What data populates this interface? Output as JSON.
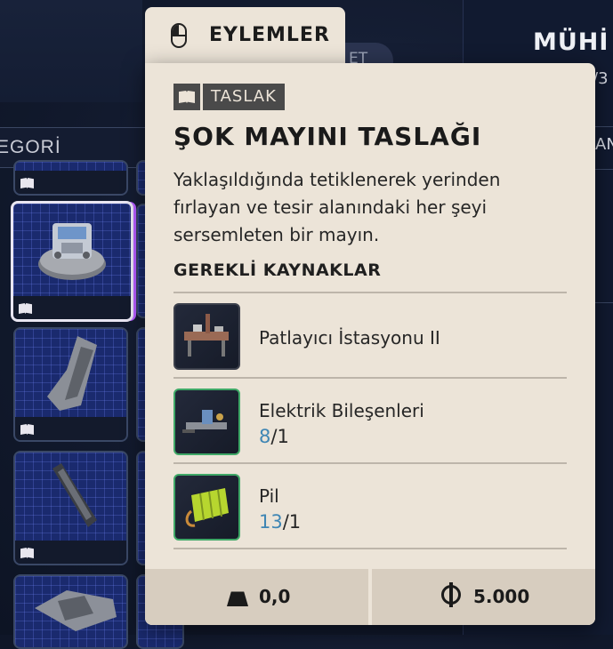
{
  "background": {
    "categories_label": "EGORİ",
    "ghost_tab_label": "ET",
    "right_title": "MÜHİ",
    "right_fraction": "/3",
    "right_label": "AN"
  },
  "actions_tab": {
    "label": "EYLEMLER",
    "icon": "mouse-icon"
  },
  "item": {
    "type_badge": "TASLAK",
    "type_icon": "book-icon",
    "name": "ŞOK MAYINI TASLAĞI",
    "description": "Yaklaşıldığında tetiklenerek yerinden fırlayan ve tesir alanındaki her şeyi sersemleten bir mayın."
  },
  "resources": {
    "title": "GEREKLİ KAYNAKLAR",
    "items": [
      {
        "name": "Patlayıcı İstasyonu II",
        "have": "",
        "need": ""
      },
      {
        "name": "Elektrik Bileşenleri",
        "have": "8",
        "need": "/1"
      },
      {
        "name": "Pil",
        "have": "13",
        "need": "/1"
      }
    ]
  },
  "footer": {
    "weight": "0,0",
    "price": "5.000"
  },
  "colors": {
    "card_bg": "#ece4d8",
    "have_count": "#3f86b4",
    "selected_accent": "#b55cff"
  }
}
